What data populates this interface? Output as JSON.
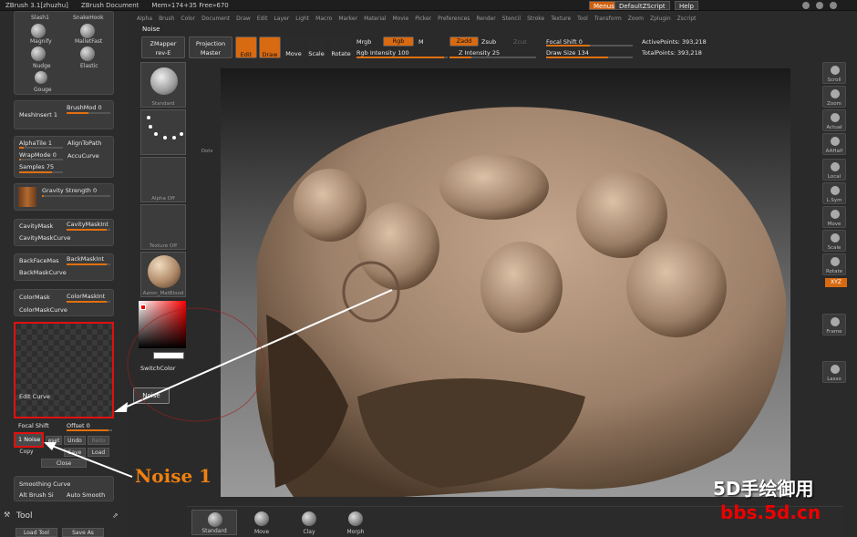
{
  "titlebar": {
    "app": "ZBrush  3.1[zhuzhu]",
    "doc": "ZBrush Document",
    "mem": "Mem»174+35 Free»670",
    "menus": "Menus",
    "script": "DefaultZScript",
    "help": "Help"
  },
  "menubar": [
    "Alpha",
    "Brush",
    "Color",
    "Document",
    "Draw",
    "Edit",
    "Layer",
    "Light",
    "Macro",
    "Marker",
    "Material",
    "Movie",
    "Picker",
    "Preferences",
    "Render",
    "Stencil",
    "Stroke",
    "Texture",
    "Tool",
    "Transform",
    "Zoom",
    "Zplugin",
    "Zscript"
  ],
  "palette_title": "Noise",
  "top_toolbar": {
    "zmapper": "ZMapper",
    "zmapper_sub": "rev-E",
    "projection": "Projection",
    "projection_sub": "Master",
    "edit": "Edit",
    "draw": "Draw",
    "move": "Move",
    "scale": "Scale",
    "rotate": "Rotate",
    "mrgb": "Mrgb",
    "rgb": "Rgb",
    "m": "M",
    "rgb_intensity": "Rgb Intensity 100",
    "zadd": "Zadd",
    "zsub": "Zsub",
    "zcut": "Zcut",
    "z_intensity": "Z Intensity 25",
    "focal_shift": "Focal Shift 0",
    "draw_size": "Draw Size 134",
    "active_points": "ActivePoints: 393,218",
    "total_points": "TotalPoints: 393,218"
  },
  "brushes": [
    {
      "label": "Slash1"
    },
    {
      "label": "SnakeHook"
    },
    {
      "label": "Magnify"
    },
    {
      "label": "MalletFast"
    },
    {
      "label": "Nudge"
    },
    {
      "label": "Elastic"
    },
    {
      "label": "Gouge"
    }
  ],
  "left_panel": {
    "brushmod": "BrushMod 0",
    "meshinsert": "MeshInsert 1",
    "alphatile": "AlphaTile 1",
    "aligntopath": "AlignToPath",
    "wrapmode": "WrapMode 0",
    "accucurve": "AccuCurve",
    "samples": "Samples 75",
    "gravity": "Gravity Strength 0",
    "cavitymask": "CavityMask",
    "cavitymaskint": "CavityMaskInt",
    "cavitymaskcurve": "CavityMaskCurve",
    "backfacemask": "BackFaceMas",
    "backmaskint": "BackMaskInt",
    "backmaskcurve": "BackMaskCurve",
    "colormask": "ColorMask",
    "colormaskint": "ColorMaskInt",
    "colormaskcurve": "ColorMaskCurve",
    "edit_curve": "Edit Curve",
    "focal_shift": "Focal Shift",
    "offset": "Offset 0",
    "noise": "1 Noise",
    "reset": "eset",
    "undo": "Undo",
    "redo": "Redo",
    "copy": "Copy",
    "save": "Save",
    "load": "Load",
    "close": "Close",
    "smoothing_curve": "Smoothing Curve",
    "alt_brush": "Alt Brush Si",
    "auto_smooth": "Auto Smooth",
    "tool": "Tool",
    "load_tool": "Load Tool",
    "save_as": "Save As"
  },
  "tool_slots": [
    {
      "label": "Standard"
    },
    {
      "label": "Dots"
    },
    {
      "label": "Alpha Off"
    },
    {
      "label": "Texture Off"
    },
    {
      "label": "Aaron_MatBlood"
    }
  ],
  "switchcolor": "SwitchColor",
  "tooltip": "Noise",
  "right_rail": [
    {
      "label": "Scroll"
    },
    {
      "label": "Zoom"
    },
    {
      "label": "Actual"
    },
    {
      "label": "AAHalf"
    },
    {
      "label": "Local"
    },
    {
      "label": "L.Sym"
    },
    {
      "label": "Move"
    },
    {
      "label": "Scale"
    },
    {
      "label": "Rotate"
    },
    {
      "label": "Frame"
    },
    {
      "label": "Lasso"
    }
  ],
  "xyz_badge": "XYZ",
  "bottom_slots": [
    {
      "label": "Standard"
    },
    {
      "label": "Move"
    },
    {
      "label": "Clay"
    },
    {
      "label": "Morph"
    }
  ],
  "annotation": "Noise 1",
  "watermark_top": "5D手绘御用",
  "watermark_bottom": "bbs.5d.cn",
  "colors": {
    "accent": "#e07010",
    "highlight_red": "#e01010"
  }
}
